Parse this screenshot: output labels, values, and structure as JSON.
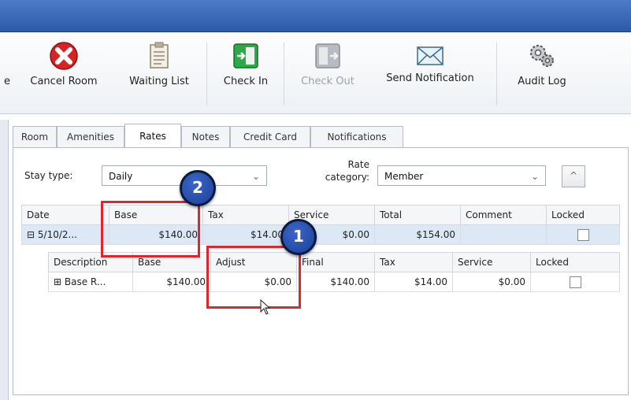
{
  "toolbar": {
    "items": [
      {
        "label": "Cancel Room",
        "icon": "cancel-room-icon"
      },
      {
        "label": "Waiting List",
        "icon": "waiting-list-icon"
      },
      {
        "label": "Check In",
        "icon": "check-in-icon"
      },
      {
        "label": "Check Out",
        "icon": "check-out-icon",
        "disabled": true
      },
      {
        "label": "Send Notification",
        "icon": "envelope-icon"
      },
      {
        "label": "Audit Log",
        "icon": "gears-icon"
      }
    ]
  },
  "tabs": [
    "Room",
    "Amenities",
    "Rates",
    "Notes",
    "Credit Card",
    "Notifications"
  ],
  "active_tab": "Rates",
  "form": {
    "stay_type_label": "Stay type:",
    "stay_type_value": "Daily",
    "rate_category_label_1": "Rate",
    "rate_category_label_2": "category:",
    "rate_category_value": "Member",
    "up_symbol": "^"
  },
  "rates_grid": {
    "headers": [
      "Date",
      "Base",
      "Tax",
      "Service",
      "Total",
      "Comment",
      "Locked"
    ],
    "row": {
      "date": "5/10/2...",
      "base": "$140.00",
      "tax": "$14.00",
      "service": "$0.00",
      "total": "$154.00",
      "comment": "",
      "expand": "⊟"
    }
  },
  "detail_grid": {
    "headers": [
      "Description",
      "Base",
      "Adjust",
      "Final",
      "Tax",
      "Service",
      "Locked"
    ],
    "row": {
      "expand": "⊞",
      "description": "Base R...",
      "base": "$140.00",
      "adjust": "$0.00",
      "final": "$140.00",
      "tax": "$14.00",
      "service": "$0.00"
    }
  },
  "callouts": [
    "1",
    "2"
  ],
  "colors": {
    "highlight": "#e0262a",
    "badge": "#1b3f94",
    "selected_row": "#dde8f7"
  }
}
